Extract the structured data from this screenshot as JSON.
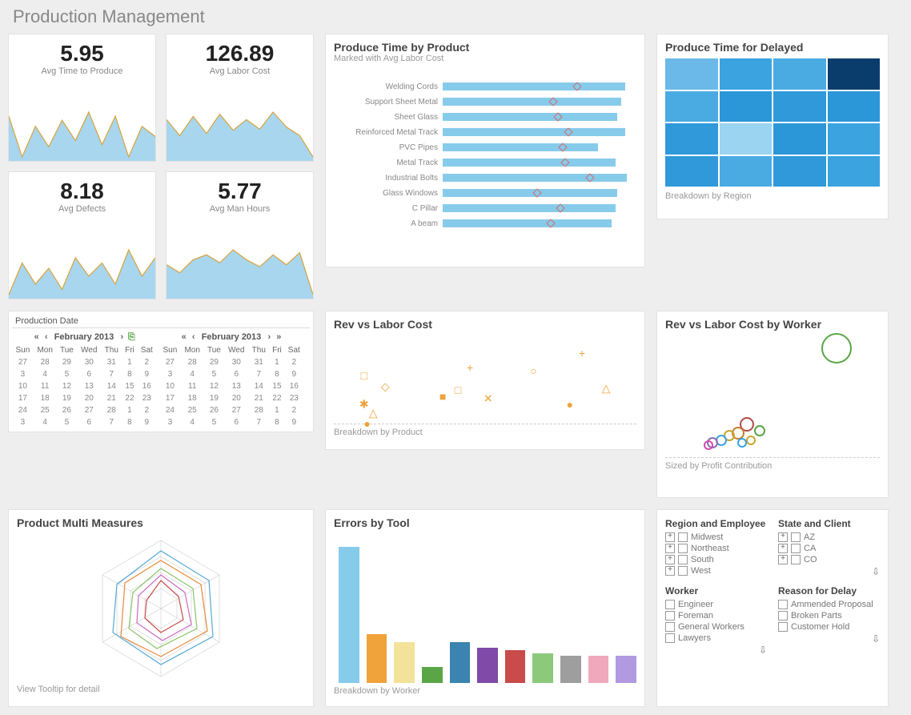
{
  "page_title": "Production Management",
  "kpi": [
    {
      "value": "5.95",
      "label": "Avg Time to Produce",
      "spark": [
        60,
        40,
        55,
        45,
        58,
        48,
        62,
        46,
        60,
        40,
        55,
        50
      ]
    },
    {
      "value": "126.89",
      "label": "Avg Labor Cost",
      "spark": [
        55,
        40,
        58,
        42,
        60,
        45,
        55,
        46,
        62,
        48,
        40,
        20
      ]
    },
    {
      "value": "8.18",
      "label": "Avg Defects",
      "spark": [
        48,
        60,
        52,
        58,
        50,
        62,
        55,
        60,
        52,
        65,
        55,
        62
      ]
    },
    {
      "value": "5.77",
      "label": "Avg Man Hours",
      "spark": [
        50,
        42,
        55,
        60,
        52,
        65,
        55,
        48,
        60,
        50,
        62,
        20
      ]
    }
  ],
  "ptbp": {
    "title": "Produce Time by Product",
    "subtitle": "Marked with Avg Labor Cost",
    "rows": [
      {
        "name": "Welding Cords",
        "bar_pct": 95,
        "mark_pct": 72
      },
      {
        "name": "Support Sheet Metal",
        "bar_pct": 93,
        "mark_pct": 60
      },
      {
        "name": "Sheet Glass",
        "bar_pct": 91,
        "mark_pct": 64
      },
      {
        "name": "Reinforced Metal Track",
        "bar_pct": 95,
        "mark_pct": 67
      },
      {
        "name": "PVC Pipes",
        "bar_pct": 81,
        "mark_pct": 75
      },
      {
        "name": "Metal Track",
        "bar_pct": 90,
        "mark_pct": 69
      },
      {
        "name": "Industrial Bolts",
        "bar_pct": 96,
        "mark_pct": 78
      },
      {
        "name": "Glass Windows",
        "bar_pct": 91,
        "mark_pct": 52
      },
      {
        "name": "C Pillar",
        "bar_pct": 90,
        "mark_pct": 66
      },
      {
        "name": "A beam",
        "bar_pct": 88,
        "mark_pct": 62
      }
    ]
  },
  "heatmap": {
    "title": "Produce Time for Delayed",
    "subtitle": "Breakdown by Region",
    "colors": [
      "#6bb9e8",
      "#3aa3e0",
      "#4aabe3",
      "#0a3d6b",
      "#4aabe3",
      "#2b96d8",
      "#2f99da",
      "#2b96d8",
      "#2f99da",
      "#9ad4f0",
      "#2b96d8",
      "#3aa3e0",
      "#2f99da",
      "#4aabe3",
      "#2f99da",
      "#3aa3e0"
    ]
  },
  "rvlc": {
    "title": "Rev vs Labor Cost",
    "subtitle": "Breakdown by Product",
    "points": [
      {
        "x_pct": 10,
        "y_pct": 45,
        "glyph": "□"
      },
      {
        "x_pct": 17,
        "y_pct": 58,
        "glyph": "◇"
      },
      {
        "x_pct": 10,
        "y_pct": 78,
        "glyph": "✱"
      },
      {
        "x_pct": 13,
        "y_pct": 88,
        "glyph": "△"
      },
      {
        "x_pct": 11,
        "y_pct": 100,
        "glyph": "●"
      },
      {
        "x_pct": 36,
        "y_pct": 69,
        "glyph": "■"
      },
      {
        "x_pct": 41,
        "y_pct": 62,
        "glyph": "□"
      },
      {
        "x_pct": 45,
        "y_pct": 36,
        "glyph": "+"
      },
      {
        "x_pct": 51,
        "y_pct": 72,
        "glyph": "✕"
      },
      {
        "x_pct": 66,
        "y_pct": 40,
        "glyph": "○"
      },
      {
        "x_pct": 78,
        "y_pct": 78,
        "glyph": "●"
      },
      {
        "x_pct": 82,
        "y_pct": 20,
        "glyph": "+"
      },
      {
        "x_pct": 90,
        "y_pct": 60,
        "glyph": "△"
      }
    ]
  },
  "rvlc_worker": {
    "title": "Rev vs Labor Cost by Worker",
    "subtitle": "Sized by Profit Contribution",
    "circles": [
      {
        "x_pct": 80,
        "y_pct": 8,
        "d": 34,
        "color": "#5aa646"
      },
      {
        "x_pct": 38,
        "y_pct": 72,
        "d": 14,
        "color": "#b24b4b"
      },
      {
        "x_pct": 34,
        "y_pct": 80,
        "d": 12,
        "color": "#c77c2d"
      },
      {
        "x_pct": 30,
        "y_pct": 82,
        "d": 10,
        "color": "#c7a62d"
      },
      {
        "x_pct": 26,
        "y_pct": 86,
        "d": 10,
        "color": "#3aa3e0"
      },
      {
        "x_pct": 22,
        "y_pct": 88,
        "d": 10,
        "color": "#8b6fb0"
      },
      {
        "x_pct": 44,
        "y_pct": 78,
        "d": 10,
        "color": "#5aa646"
      },
      {
        "x_pct": 20,
        "y_pct": 90,
        "d": 8,
        "color": "#d24bb0"
      },
      {
        "x_pct": 40,
        "y_pct": 86,
        "d": 8,
        "color": "#c7a62d"
      },
      {
        "x_pct": 36,
        "y_pct": 88,
        "d": 8,
        "color": "#3aa3e0"
      }
    ]
  },
  "radar": {
    "title": "Product Multi Measures",
    "footnote": "View Tooltip for detail"
  },
  "errors": {
    "title": "Errors by Tool",
    "subtitle": "Breakdown by Worker",
    "bars": [
      {
        "h_pct": 100,
        "color": "#87cbeb"
      },
      {
        "h_pct": 36,
        "color": "#f0a33a"
      },
      {
        "h_pct": 30,
        "color": "#f3e39a"
      },
      {
        "h_pct": 12,
        "color": "#5aa646"
      },
      {
        "h_pct": 30,
        "color": "#3b83b0"
      },
      {
        "h_pct": 26,
        "color": "#7f4aa8"
      },
      {
        "h_pct": 24,
        "color": "#c94b4b"
      },
      {
        "h_pct": 22,
        "color": "#8cc97b"
      },
      {
        "h_pct": 20,
        "color": "#9e9e9e"
      },
      {
        "h_pct": 20,
        "color": "#f0a8bd"
      },
      {
        "h_pct": 20,
        "color": "#b19ae0"
      }
    ]
  },
  "filters": {
    "region_title": "Region and Employee",
    "regions": [
      "Midwest",
      "Northeast",
      "South",
      "West"
    ],
    "state_title": "State and Client",
    "states": [
      "AZ",
      "CA",
      "CO"
    ],
    "worker_title": "Worker",
    "workers": [
      "Engineer",
      "Foreman",
      "General Workers",
      "Lawyers"
    ],
    "reason_title": "Reason for Delay",
    "reasons": [
      "Ammended Proposal",
      "Broken Parts",
      "Customer Hold"
    ]
  },
  "calendar": {
    "title": "Production Date",
    "months": [
      "February 2013",
      "February 2013"
    ],
    "weekdays": [
      "Sun",
      "Mon",
      "Tue",
      "Wed",
      "Thu",
      "Fri",
      "Sat"
    ],
    "nav_prev_fast": "«",
    "nav_prev": "‹",
    "nav_next": "›",
    "nav_next_fast": "»",
    "weeks": [
      [
        "27",
        "28",
        "29",
        "30",
        "31",
        "1",
        "2"
      ],
      [
        "3",
        "4",
        "5",
        "6",
        "7",
        "8",
        "9"
      ],
      [
        "10",
        "11",
        "12",
        "13",
        "14",
        "15",
        "16"
      ],
      [
        "17",
        "18",
        "19",
        "20",
        "21",
        "22",
        "23"
      ],
      [
        "24",
        "25",
        "26",
        "27",
        "28",
        "1",
        "2"
      ],
      [
        "3",
        "4",
        "5",
        "6",
        "7",
        "8",
        "9"
      ]
    ]
  },
  "chart_data": [
    {
      "type": "bar",
      "title": "Produce Time by Product",
      "categories": [
        "Welding Cords",
        "Support Sheet Metal",
        "Sheet Glass",
        "Reinforced Metal Track",
        "PVC Pipes",
        "Metal Track",
        "Industrial Bolts",
        "Glass Windows",
        "C Pillar",
        "A beam"
      ],
      "values": [
        95,
        93,
        91,
        95,
        81,
        90,
        96,
        91,
        90,
        88
      ],
      "overlay": {
        "name": "Avg Labor Cost",
        "values": [
          72,
          60,
          64,
          67,
          75,
          69,
          78,
          52,
          66,
          62
        ]
      }
    },
    {
      "type": "heatmap",
      "title": "Produce Time for Delayed",
      "grid": [
        4,
        4
      ]
    },
    {
      "type": "scatter",
      "title": "Rev vs Labor Cost"
    },
    {
      "type": "scatter",
      "title": "Rev vs Labor Cost by Worker"
    },
    {
      "type": "bar",
      "title": "Errors by Tool",
      "values": [
        100,
        36,
        30,
        12,
        30,
        26,
        24,
        22,
        20,
        20,
        20
      ]
    }
  ]
}
